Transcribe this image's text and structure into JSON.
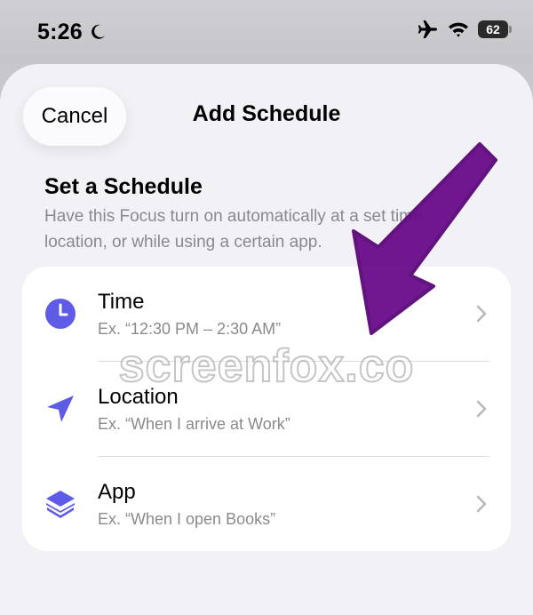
{
  "status_bar": {
    "time": "5:26",
    "battery": "62",
    "icons": [
      "moon-icon",
      "airplane-icon",
      "wifi-icon",
      "battery-icon"
    ]
  },
  "sheet": {
    "cancel_label": "Cancel",
    "title": "Add Schedule"
  },
  "section": {
    "title": "Set a Schedule",
    "description": "Have this Focus turn on automatically at a set time, location, or while using a certain app."
  },
  "options": [
    {
      "title": "Time",
      "subtitle": "Ex. “12:30 PM – 2:30 AM”",
      "icon": "clock-icon"
    },
    {
      "title": "Location",
      "subtitle": "Ex. “When I arrive at Work”",
      "icon": "location-arrow-icon"
    },
    {
      "title": "App",
      "subtitle": "Ex. “When I open Books”",
      "icon": "app-layers-icon"
    }
  ],
  "watermark": "screenfox.co",
  "colors": {
    "accent": "#5e5ce6",
    "annotation_arrow": "#6a0b8a"
  }
}
